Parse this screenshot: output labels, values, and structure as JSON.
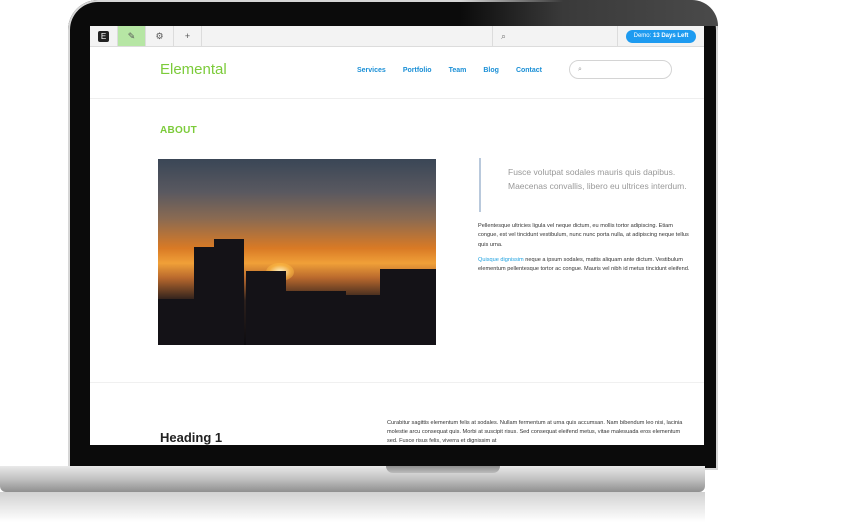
{
  "toolbar": {
    "logo_glyph": "E",
    "edit_glyph": "✎",
    "settings_glyph": "⚙",
    "add_glyph": "+",
    "search_glyph": "⌕",
    "demo_prefix": "Demo:",
    "demo_days": "13 Days Left"
  },
  "header": {
    "brand": "Elemental",
    "nav": [
      "Services",
      "Portfolio",
      "Team",
      "Blog",
      "Contact"
    ],
    "search_glyph": "⌕"
  },
  "about": {
    "title": "ABOUT",
    "quote": "Fusce volutpat sodales mauris quis dapibus. Maecenas convallis, libero eu ultrices interdum.",
    "paragraph1": "Pellentesque ultricies ligula vel neque dictum, eu mollis tortor adipiscing. Etiam congue, est vel tincidunt vestibulum, nunc nunc porta nulla, at adipiscing neque tellus quis urna.",
    "paragraph2_link": "Quisque dignissim",
    "paragraph2_rest": " neque a ipsum sodales, mattis aliquam ante dictum. Vestibulum elementum pellentesque tortor ac congue. Mauris vel nibh id metus tincidunt eleifend."
  },
  "section2": {
    "heading": "Heading 1",
    "paragraph": "Curabitur sagittis elementum felis at sodales. Nullam fermentum at urna quis accumsan. Nam bibendum leo nisi, lacinia molestie arcu consequat quis. Morbi at suscipit risus. Sed consequat eleifend metus, vitae malesuada eros elementum sed. Fusce risus felis, viverra et dignissim at"
  },
  "colors": {
    "brand_green": "#7ccb3a",
    "nav_blue": "#1a8fd6",
    "demo_blue": "#1e9bf0",
    "edit_active": "#b6e6a4"
  }
}
